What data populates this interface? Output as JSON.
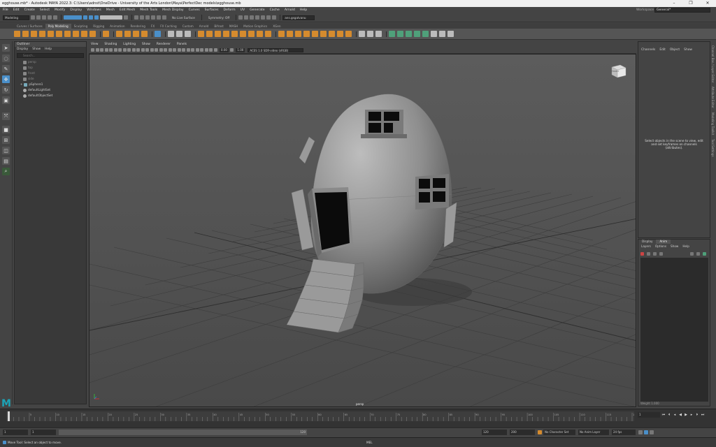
{
  "window": {
    "title": "egghouse.mb* - Autodesk MAYA 2022.3: C:\\Users\\adnst\\OneDrive - University of the Arts London\\Maya\\PerfectDec models\\egghouse.mb",
    "controls": [
      "–",
      "❐",
      "✕"
    ]
  },
  "menubar": [
    "File",
    "Edit",
    "Create",
    "Select",
    "Modify",
    "Display",
    "Windows",
    "Mesh",
    "Edit Mesh",
    "Mesh Tools",
    "Mesh Display",
    "Curves",
    "Surfaces",
    "Deform",
    "UV",
    "Generate",
    "Cache",
    "Arnold",
    "Help"
  ],
  "workspace": {
    "label": "Workspace :",
    "value": "General*"
  },
  "statusline": {
    "menuset": "Modeling",
    "live_surface": "No Live Surface",
    "symmetry": "Symmetry: Off",
    "login": "ans.gsgalvanu"
  },
  "shelf_tabs": [
    "Curves / Surfaces",
    "Poly Modeling",
    "Sculpting",
    "Rigging",
    "Animation",
    "Rendering",
    "FX",
    "FX Caching",
    "Custom",
    "Arnold",
    "Bifrost",
    "MASH",
    "Motion Graphics",
    "XGen"
  ],
  "shelf_active": "Poly Modeling",
  "outliner": {
    "title": "Outliner",
    "menu": [
      "Display",
      "Show",
      "Help"
    ],
    "search_placeholder": "Search...",
    "items": [
      {
        "label": "persp",
        "dim": true
      },
      {
        "label": "top",
        "dim": true
      },
      {
        "label": "front",
        "dim": true
      },
      {
        "label": "side",
        "dim": true
      },
      {
        "label": "pSphere1",
        "dim": false
      },
      {
        "label": "defaultLightSet",
        "dim": false
      },
      {
        "label": "defaultObjectSet",
        "dim": false
      }
    ]
  },
  "viewport": {
    "menu": [
      "View",
      "Shading",
      "Lighting",
      "Show",
      "Renderer",
      "Panels"
    ],
    "exposure": "0.00",
    "gamma": "1.00",
    "colorspace": "ACES 1.0 SDR-video (sRGB)",
    "camera": "persp",
    "viewcube_label": "FRONT"
  },
  "channelbox": {
    "menu": [
      "Channels",
      "Edit",
      "Object",
      "Show"
    ],
    "message": "Select objects in the scene to view, edit and set keyframes on channels (attributes)."
  },
  "layers": {
    "tabs": [
      "Display",
      "Anim"
    ],
    "active_tab": "Anim",
    "menu": [
      "Layers",
      "Options",
      "Show",
      "Help"
    ],
    "footer": "Weight 1.000"
  },
  "side_tabs": [
    "Channel Box / Layer Editor",
    "Attribute Editor",
    "Modeling Toolkit",
    "Tool Settings"
  ],
  "timeslider": {
    "ticks": [
      "5",
      "10",
      "15",
      "20",
      "25",
      "30",
      "35",
      "40",
      "45",
      "50",
      "55",
      "60",
      "65",
      "70",
      "75",
      "80",
      "85",
      "90",
      "95",
      "100",
      "105",
      "110",
      "115",
      "120"
    ],
    "current_frame": "1"
  },
  "range": {
    "start": "1",
    "start_inner": "1",
    "range_end_label": "120",
    "end_inner": "120",
    "end": "200",
    "character_set": "No Character Set",
    "anim_layer": "No Anim Layer",
    "fps": "24 fps"
  },
  "cmdline": {
    "help": "Move Tool: Select an object to move.",
    "language": "MEL"
  }
}
